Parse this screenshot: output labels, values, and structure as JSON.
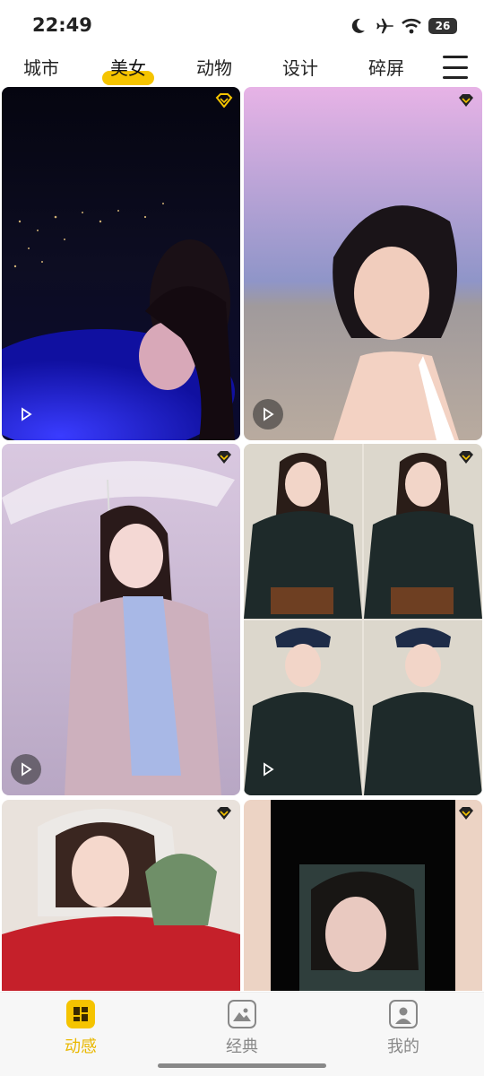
{
  "status": {
    "time": "22:49",
    "battery": "26"
  },
  "tabs": [
    {
      "label": "城市",
      "active": false
    },
    {
      "label": "美女",
      "active": true
    },
    {
      "label": "动物",
      "active": false
    },
    {
      "label": "设计",
      "active": false
    },
    {
      "label": "碎屏",
      "active": false
    }
  ],
  "grid": {
    "items": [
      {
        "icon": "play-icon",
        "vip": true
      },
      {
        "icon": "play-icon",
        "vip": true
      },
      {
        "icon": "play-icon",
        "vip": true
      },
      {
        "icon": "play-icon",
        "vip": true
      },
      {
        "vip": true
      },
      {
        "vip": true
      }
    ]
  },
  "bottom_nav": [
    {
      "label": "动感",
      "active": true,
      "icon": "dynamic-icon"
    },
    {
      "label": "经典",
      "active": false,
      "icon": "picture-icon"
    },
    {
      "label": "我的",
      "active": false,
      "icon": "profile-icon"
    }
  ],
  "colors": {
    "accent": "#f5c400",
    "nav_active": "#e9b800"
  }
}
